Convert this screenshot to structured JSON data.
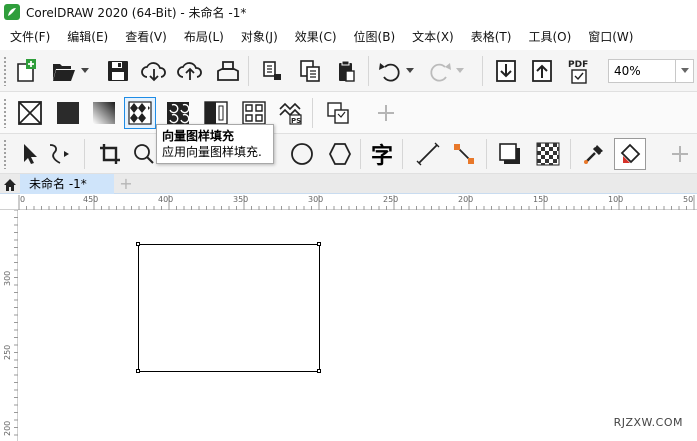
{
  "window": {
    "title": "CorelDRAW 2020 (64-Bit) - 未命名 -1*"
  },
  "menu": [
    "文件(F)",
    "编辑(E)",
    "查看(V)",
    "布局(L)",
    "对象(J)",
    "效果(C)",
    "位图(B)",
    "文本(X)",
    "表格(T)",
    "工具(O)",
    "窗口(W)"
  ],
  "standard_toolbar": {
    "zoom_value": "40%",
    "pdf_label": "PDF"
  },
  "tooltip": {
    "title": "向量图样填充",
    "description": "应用向量图样填充."
  },
  "properties_toolbar": {
    "text_tool_glyph": "字"
  },
  "document_tab": {
    "label": "未命名 -1*",
    "add_label": "+"
  },
  "ruler": {
    "horizontal": [
      "0",
      "450",
      "400",
      "350",
      "300",
      "250",
      "200",
      "150",
      "100",
      "50"
    ],
    "vertical": [
      "300",
      "250",
      "200"
    ]
  },
  "watermark": "RJZXW.COM",
  "colors": {
    "accent_blue": "#cfe4fa",
    "logo_green": "#2f9e3b",
    "orange_accent": "#e8782a",
    "red_accent": "#d6332a"
  }
}
